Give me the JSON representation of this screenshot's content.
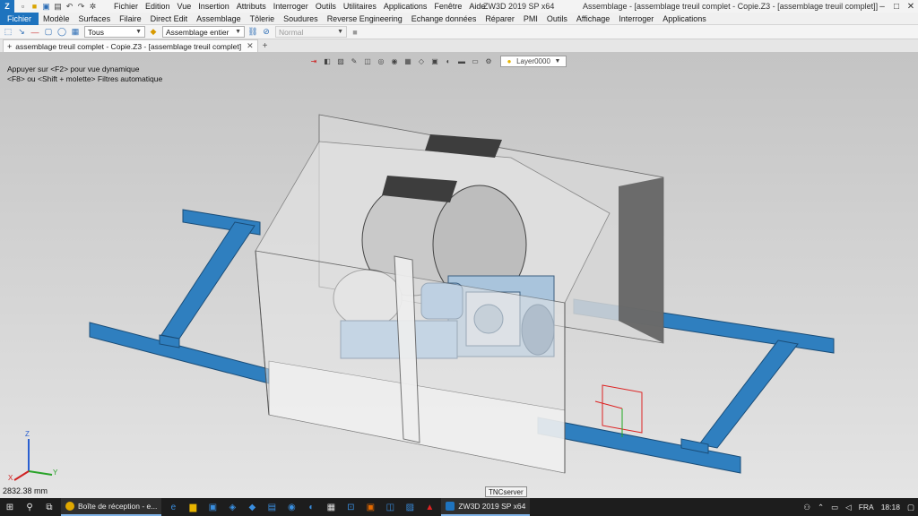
{
  "titlebar": {
    "menus": [
      "Fichier",
      "Edition",
      "Vue",
      "Insertion",
      "Attributs",
      "Interroger",
      "Outils",
      "Utilitaires",
      "Applications",
      "Fenêtre",
      "Aide"
    ],
    "app_title": "ZW3D 2019 SP x64",
    "doc_title": "Assemblage - [assemblage treuil complet - Copie.Z3 - [assemblage treuil complet]]"
  },
  "ribbon": {
    "tabs": [
      "Fichier",
      "Modèle",
      "Surfaces",
      "Filaire",
      "Direct Edit",
      "Assemblage",
      "Tôlerie",
      "Soudures",
      "Reverse Engineering",
      "Echange données",
      "Réparer",
      "PMI",
      "Outils",
      "Affichage",
      "Interroger",
      "Applications"
    ]
  },
  "toolbar": {
    "filter_value": "Tous",
    "assembly_value": "Assemblage entier",
    "style_value": "Normal"
  },
  "document_tab": {
    "label": "assemblage treuil complet - Copie.Z3 - [assemblage treuil complet]"
  },
  "viewport": {
    "hint_line1": "Appuyer sur <F2> pour vue dynamique",
    "hint_line2": "<F8> ou <Shift + molette> Filtres automatique",
    "layer": "Layer0000",
    "zoom_readout": "2832.38 mm",
    "tooltip": "TNCserver",
    "axis": {
      "x": "X",
      "y": "Y",
      "z": "Z"
    }
  },
  "taskbar": {
    "mail_app": "Boîte de réception - e...",
    "zw3d_app": "ZW3D 2019 SP x64",
    "language": "FRA",
    "time": "18:18"
  },
  "colors": {
    "accent": "#1e73be",
    "frame_blue": "#2f7fbf",
    "taskbar": "#1d1d1d"
  }
}
